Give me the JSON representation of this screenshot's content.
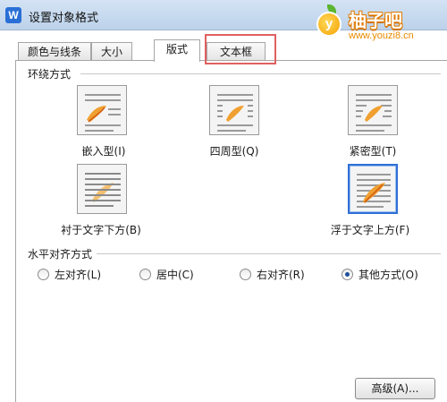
{
  "window": {
    "title": "设置对象格式",
    "app_icon": "W"
  },
  "watermark": {
    "title": "柚子吧",
    "url": "www.youzi8.cn",
    "badge": "y"
  },
  "tabs": [
    {
      "label": "颜色与线条"
    },
    {
      "label": "大小"
    },
    {
      "label": "版式"
    },
    {
      "label": "文本框"
    }
  ],
  "active_tab": "版式",
  "wrap_section": {
    "title": "环绕方式",
    "options": [
      {
        "label": "嵌入型(I)"
      },
      {
        "label": "四周型(Q)"
      },
      {
        "label": "紧密型(T)"
      },
      {
        "label": "衬于文字下方(B)"
      },
      {
        "label": "浮于文字上方(F)"
      }
    ],
    "selected": "浮于文字上方(F)"
  },
  "align_section": {
    "title": "水平对齐方式",
    "options": [
      {
        "label": "左对齐(L)"
      },
      {
        "label": "居中(C)"
      },
      {
        "label": "右对齐(R)"
      },
      {
        "label": "其他方式(O)"
      }
    ],
    "selected": "其他方式(O)"
  },
  "buttons": {
    "advanced": "高级(A)..."
  },
  "colors": {
    "accent": "#2f6fd6",
    "highlight": "#e06060",
    "brand": "#f5a100"
  }
}
